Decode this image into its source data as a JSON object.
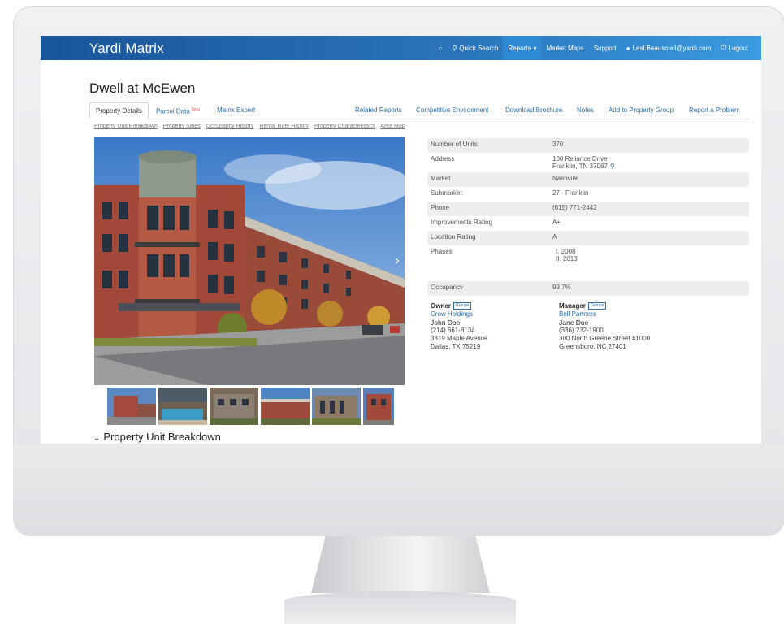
{
  "app": {
    "brand": "Yardi Matrix"
  },
  "topnav": {
    "items": [
      {
        "icon": "home-icon",
        "label": ""
      },
      {
        "icon": "search-icon",
        "label": "Quick Search"
      },
      {
        "icon": "caret-down-icon",
        "label": "Reports"
      },
      {
        "icon": "",
        "label": "Market Maps"
      },
      {
        "icon": "",
        "label": "Support"
      },
      {
        "icon": "user-icon",
        "label": "Lesl.Beausoleil@yardi.com"
      },
      {
        "icon": "power-icon",
        "label": "Logout"
      }
    ]
  },
  "property": {
    "title": "Dwell at McEwen"
  },
  "tabs": {
    "property_details": "Property Details",
    "parcel_data": "Parcel Data",
    "parcel_badge": "beta",
    "matrix_expert": "Matrix Expert",
    "related_reports": "Related Reports",
    "competitive_environment": "Competitive Environment",
    "download_brochure": "Download Brochure",
    "notes": "Notes",
    "add_to_group": "Add to Property Group",
    "report_problem": "Report a Problem"
  },
  "sublinks": {
    "unit_breakdown": "Property Unit Breakdown",
    "sales": "Property Sales",
    "occupancy_history": "Occupancy History",
    "rental_rate_history": "Rental Rate History",
    "characteristics": "Property Characteristics",
    "area_map": "Area Map"
  },
  "details": {
    "units_label": "Number of Units",
    "units_value": "370",
    "address_label": "Address",
    "address_line1": "100 Reliance Drive",
    "address_line2": "Franklin, TN 37067",
    "market_label": "Market",
    "market_value": "Nashville",
    "submarket_label": "Submarket",
    "submarket_value": "27 - Franklin",
    "phone_label": "Phone",
    "phone_value": "(615) 771-2442",
    "improvements_label": "Improvements Rating",
    "improvements_value": "A+",
    "location_label": "Location Rating",
    "location_value": "A",
    "phases_label": "Phases",
    "phase1": "I. 2008",
    "phase2": "II. 2013",
    "occupancy_label": "Occupancy",
    "occupancy_value": "99.7%"
  },
  "owner": {
    "heading": "Owner",
    "groups_button": "Groups",
    "company": "Crow Holdings",
    "name": "John Doe",
    "phone": "(214) 661-8134",
    "street": "3819 Maple Avenue",
    "city": "Dallas, TX 75219"
  },
  "manager": {
    "heading": "Manager",
    "groups_button": "Groups",
    "company": "Bell Partners",
    "name": "Jane Doe",
    "phone": "(336) 232-1900",
    "street": "300 North Greene Street #1000",
    "city": "Greensboro, NC 27401"
  },
  "section": {
    "heading": "Property Unit Breakdown"
  },
  "colors": {
    "nav_start": "#1a5599",
    "nav_end": "#3b9be0",
    "link": "#2a6db0"
  }
}
